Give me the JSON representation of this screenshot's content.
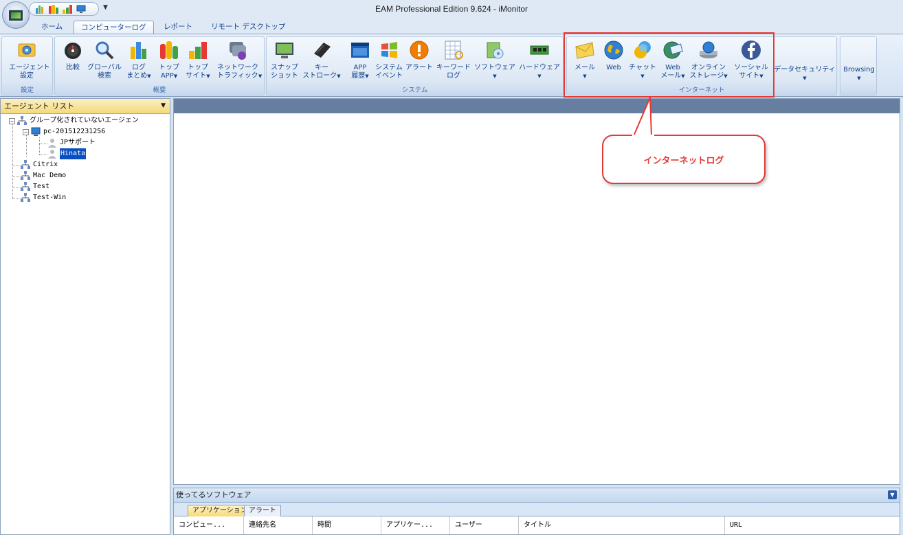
{
  "window": {
    "title": "EAM Professional Edition 9.624 - iMonitor"
  },
  "quick_access": {
    "dropdown_glyph": "▼"
  },
  "tabs": [
    {
      "label": "ホーム"
    },
    {
      "label": "コンピューターログ",
      "active": true
    },
    {
      "label": "レポート"
    },
    {
      "label": "リモート デスクトップ"
    }
  ],
  "ribbon": {
    "groups": {
      "settings": "設定",
      "overview": "概要",
      "system": "システム",
      "internet": "インターネット"
    },
    "buttons": {
      "agent_settings": {
        "line1": "エージェント",
        "line2": "設定"
      },
      "compare": {
        "line1": "比較"
      },
      "global_search": {
        "line1": "グローバル",
        "line2": "検索"
      },
      "log_summary": {
        "line1": "ログ",
        "line2": "まとめ"
      },
      "top_app": {
        "line1": "トップ",
        "line2": "APP"
      },
      "top_site": {
        "line1": "トップ",
        "line2": "サイト"
      },
      "network_traffic": {
        "line1": "ネットワーク",
        "line2": "トラフィック"
      },
      "snapshot": {
        "line1": "スナップ",
        "line2": "ショット"
      },
      "keystroke": {
        "line1": "キー",
        "line2": "ストローク"
      },
      "app_history": {
        "line1": "APP",
        "line2": "履歴"
      },
      "system_event": {
        "line1": "システム",
        "line2": "イベント"
      },
      "alert": {
        "line1": "アラート"
      },
      "keyword_log": {
        "line1": "キーワード",
        "line2": "ログ"
      },
      "software": {
        "line1": "ソフトウェア"
      },
      "hardware": {
        "line1": "ハードウェア"
      },
      "mail": {
        "line1": "メール"
      },
      "web": {
        "line1": "Web"
      },
      "chat": {
        "line1": "チャット"
      },
      "web_mail": {
        "line1": "Web",
        "line2": "メール"
      },
      "online_storage": {
        "line1": "オンライン",
        "line2": "ストレージ"
      },
      "social_site": {
        "line1": "ソーシャル",
        "line2": "サイト"
      },
      "data_security": {
        "line1": "データセキュリティ"
      },
      "browsing": {
        "line1": "Browsing"
      }
    }
  },
  "callout": {
    "text": "インターネットログ"
  },
  "agent_list": {
    "title": "エージェント リスト",
    "items": [
      {
        "label": "グループ化されていないエージェン"
      },
      {
        "label": "pc-201512231256"
      },
      {
        "label": "JPサポート"
      },
      {
        "label": "Hinata"
      },
      {
        "label": "Citrix"
      },
      {
        "label": "Mac Demo"
      },
      {
        "label": "Test"
      },
      {
        "label": "Test-Win"
      }
    ]
  },
  "bottom_pane": {
    "title": "使ってるソフトウェア",
    "tabs": [
      "アプリケーション",
      "アラート"
    ],
    "columns": [
      "コンピュー...",
      "連絡先名",
      "時間",
      "アプリケー...",
      "ユーザー",
      "タイトル",
      "URL"
    ]
  },
  "colors": {
    "highlight": "#e53935",
    "header_bar": "#667e9f",
    "selection": "#0a4fbf"
  }
}
